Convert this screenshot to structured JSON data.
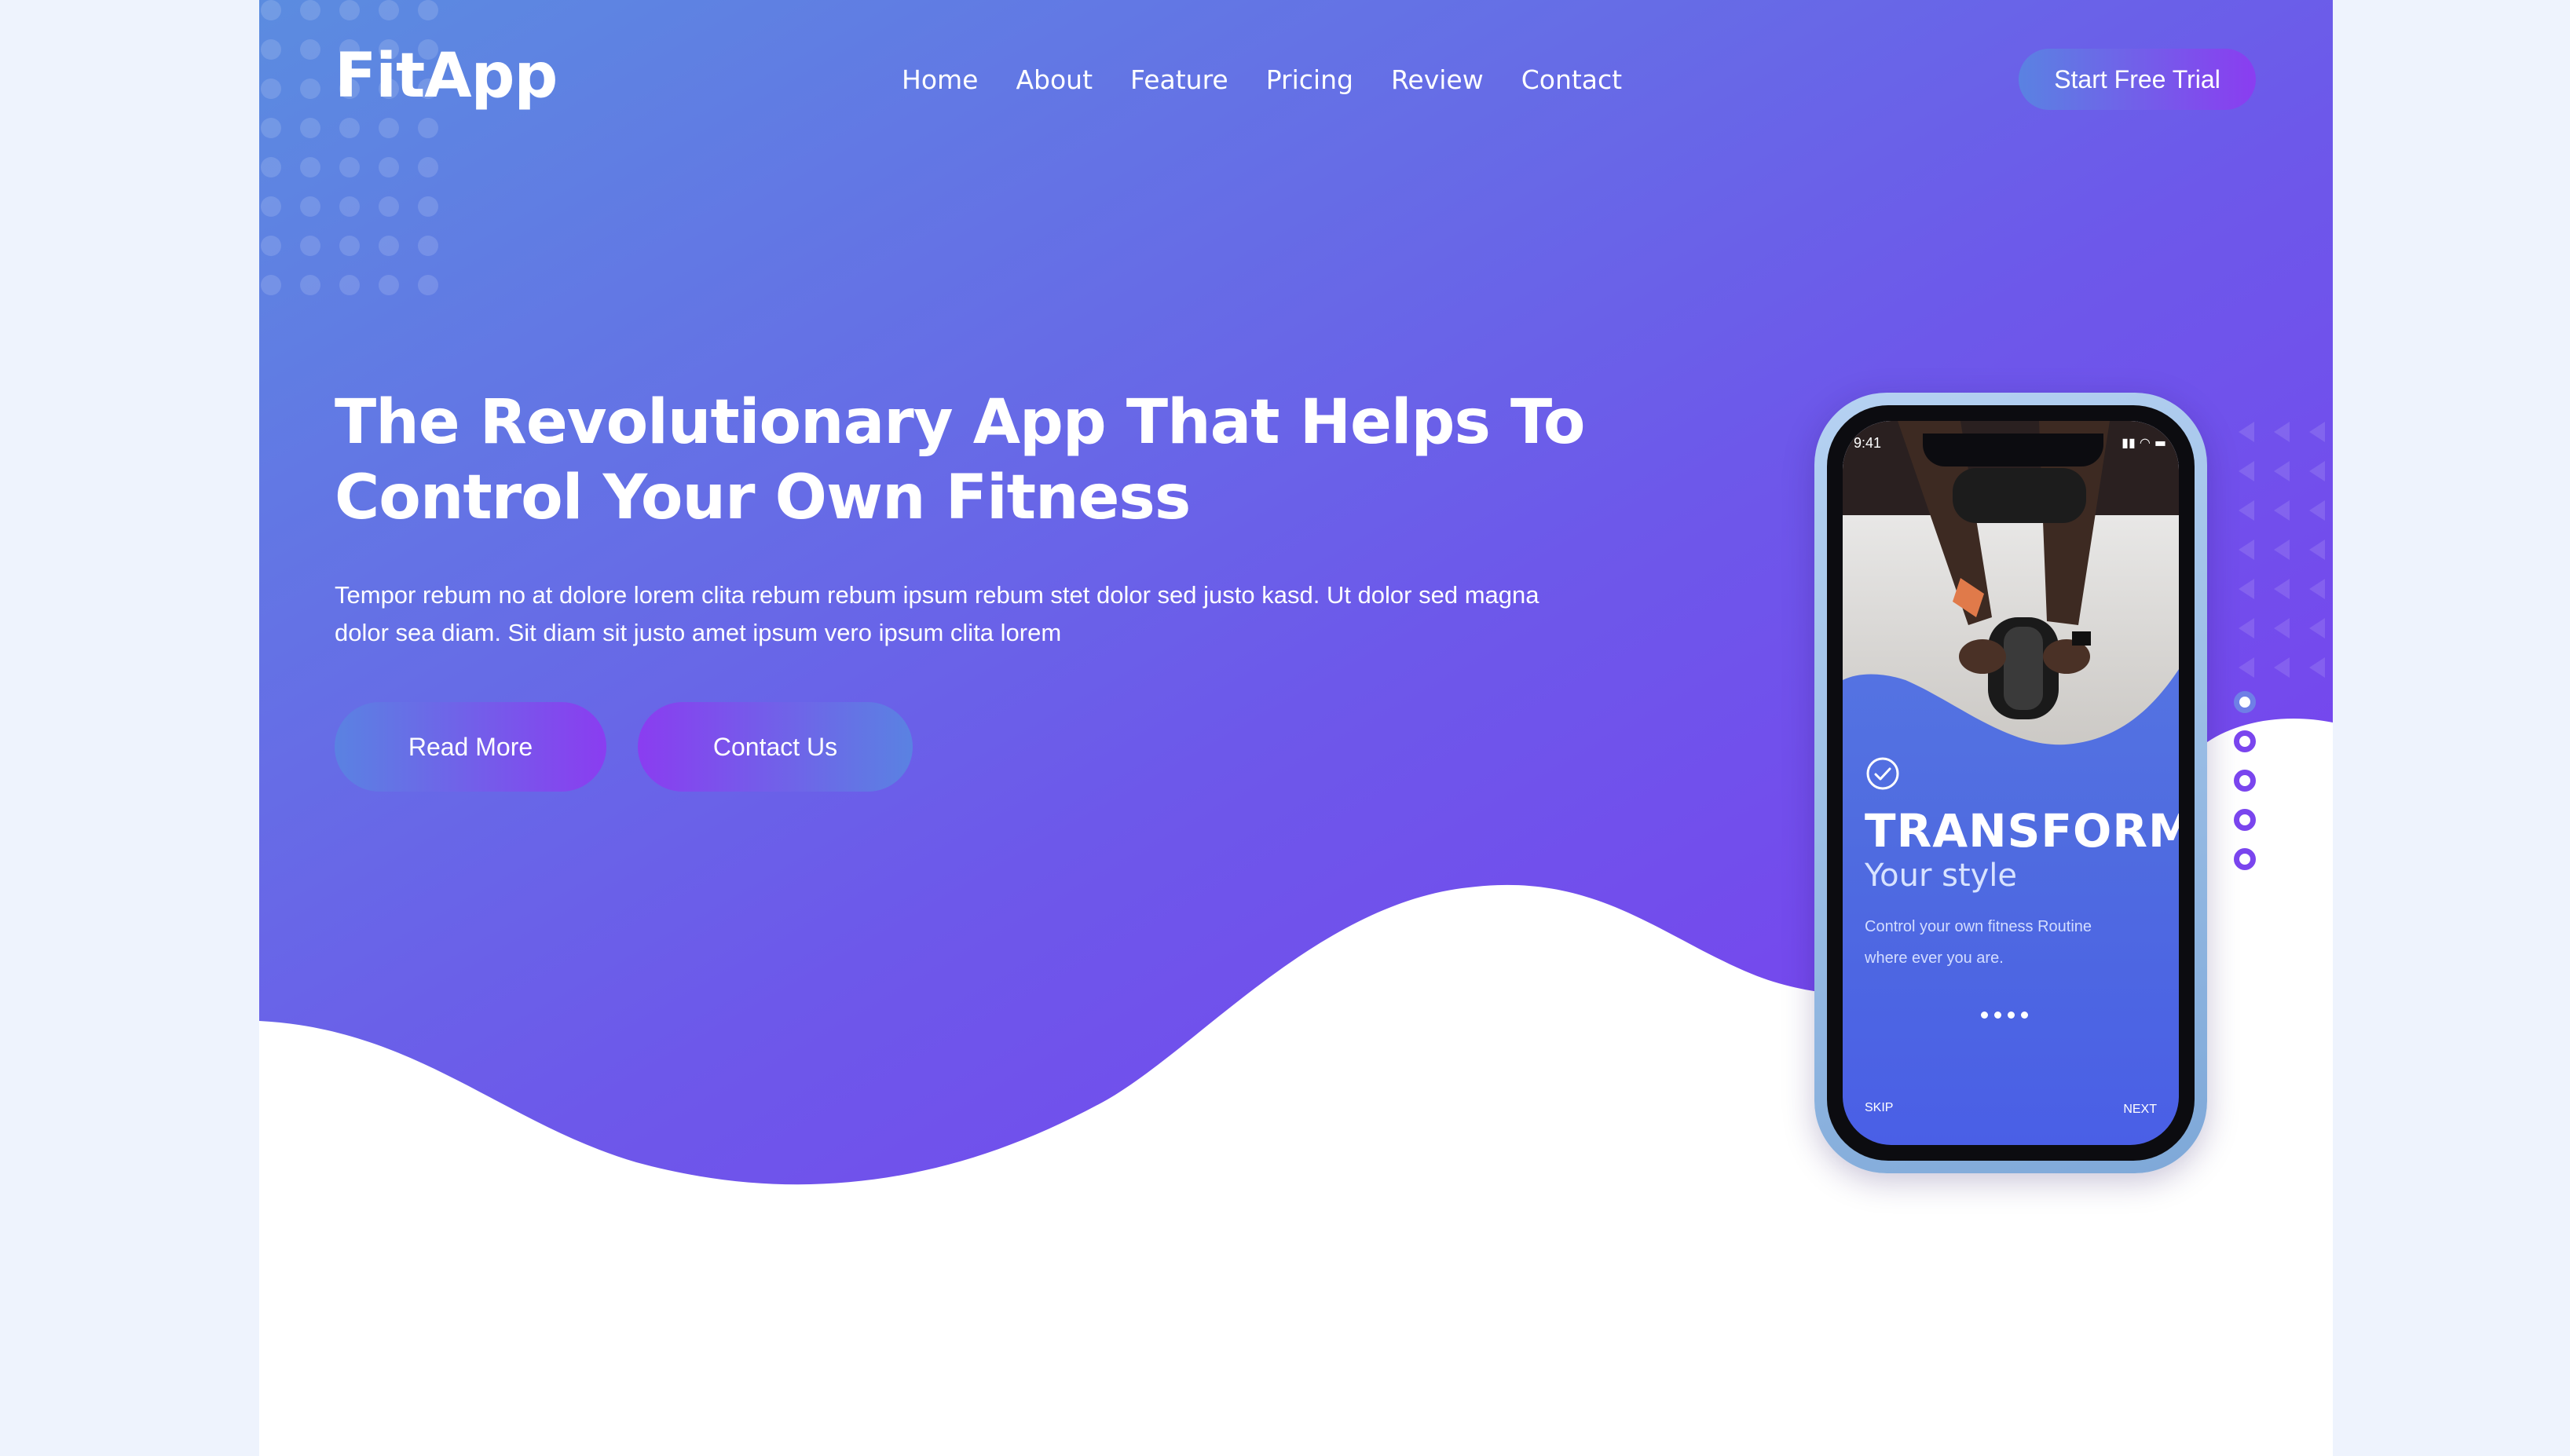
{
  "brand": {
    "logo": "FitApp"
  },
  "nav": {
    "links": [
      "Home",
      "About",
      "Feature",
      "Pricing",
      "Review",
      "Contact"
    ],
    "cta": "Start Free Trial"
  },
  "hero": {
    "title_line1": "The Revolutionary App That Helps To",
    "title_line2": "Control Your Own Fitness",
    "text_line1": "Tempor rebum no at dolore lorem clita rebum rebum ipsum rebum stet dolor sed justo kasd. Ut dolor sed magna",
    "text_line2": "dolor sea diam. Sit diam sit justo amet ipsum vero ipsum clita lorem",
    "buttons": {
      "read_more": "Read More",
      "contact": "Contact Us"
    }
  },
  "phone_screen": {
    "time": "9:41",
    "status_icons": "▮▮ ◠ ▬",
    "title": "TRANSFORM",
    "subtitle": "Your style",
    "desc_line1": "Control your own fitness Routine",
    "desc_line2": "where ever you are.",
    "skip": "SKIP",
    "next": "NEXT"
  },
  "colors": {
    "gradient_start": "#5a8be0",
    "gradient_end": "#7b3cf0",
    "accent": "#7a45ee",
    "page_bg": "#eef3fd"
  },
  "icons": {
    "check": "check-circle-icon",
    "slider_dot": "slider-dot"
  }
}
